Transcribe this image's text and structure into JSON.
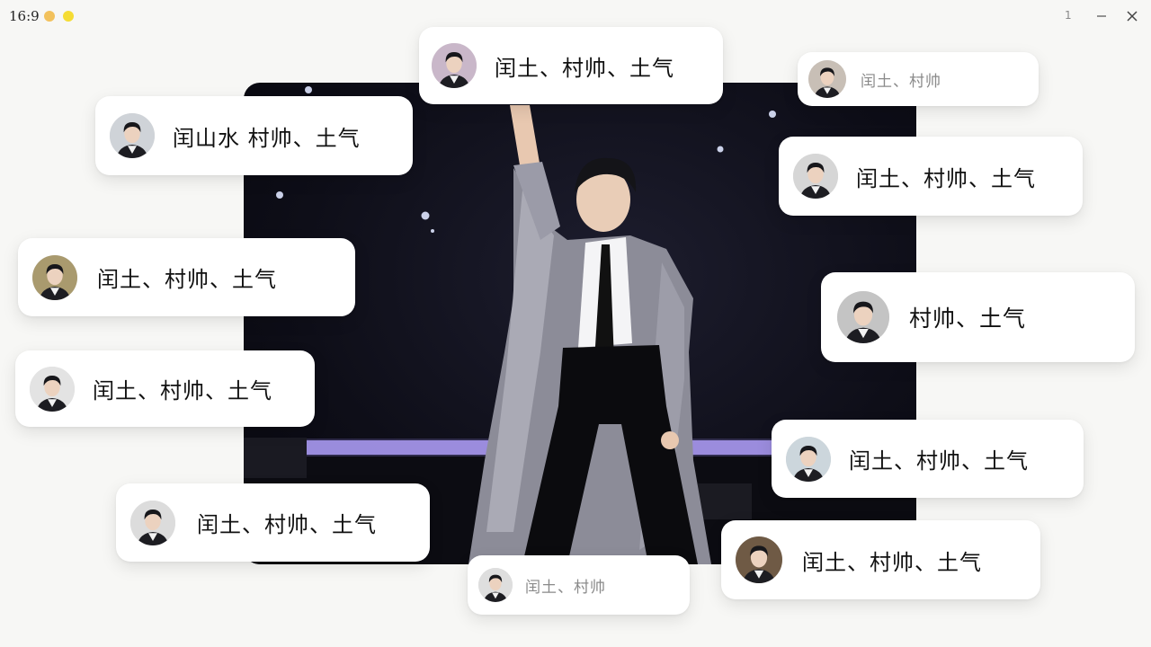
{
  "titlebar": {
    "aspect_ratio": "16:9",
    "page_indicator": "1",
    "minimize_icon": "minimize-icon",
    "close_icon": "close-icon"
  },
  "photo": {
    "icon": "concert-performer-photo"
  },
  "comments": [
    {
      "text": "闰土、村帅、土气",
      "avatar_tone": "#c9b7c9"
    },
    {
      "text": "闰土、村帅",
      "avatar_tone": "#c8bfb6"
    },
    {
      "text": "闰山水 村帅、土气",
      "avatar_tone": "#cfd3d8"
    },
    {
      "text": "闰土、村帅、土气",
      "avatar_tone": "#d6d6d6"
    },
    {
      "text": "闰土、村帅、土气",
      "avatar_tone": "#a99a6e"
    },
    {
      "text": "村帅、土气",
      "avatar_tone": "#c4c4c4"
    },
    {
      "text": "闰土、村帅、土气",
      "avatar_tone": "#e3e3e3"
    },
    {
      "text": "闰土、村帅、土气",
      "avatar_tone": "#ccd6dc"
    },
    {
      "text": "闰土、村帅、土气",
      "avatar_tone": "#dcdcdc"
    },
    {
      "text": "闰土、村帅、土气",
      "avatar_tone": "#6f5a45"
    },
    {
      "text": "闰土、村帅",
      "avatar_tone": "#dedede"
    }
  ]
}
